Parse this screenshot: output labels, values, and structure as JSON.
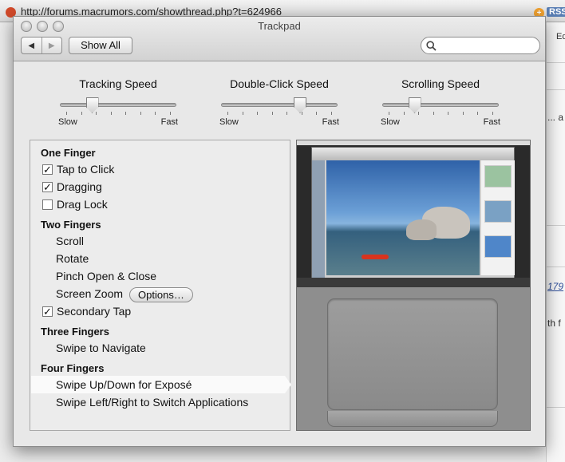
{
  "background_browser": {
    "url": "http://forums.macrumors.com/showthread.php?t=624966",
    "rss_label": "RSS",
    "side_fragments": [
      "Ed",
      "... a",
      "179",
      "th f"
    ]
  },
  "window": {
    "title": "Trackpad",
    "show_all_label": "Show All",
    "search_placeholder": ""
  },
  "sliders": [
    {
      "title": "Tracking Speed",
      "min_label": "Slow",
      "max_label": "Fast",
      "value": 0.25
    },
    {
      "title": "Double-Click Speed",
      "min_label": "Slow",
      "max_label": "Fast",
      "value": 0.7
    },
    {
      "title": "Scrolling Speed",
      "min_label": "Slow",
      "max_label": "Fast",
      "value": 0.25
    }
  ],
  "options": {
    "one_finger": {
      "heading": "One Finger",
      "tap_to_click": {
        "label": "Tap to Click",
        "checked": true
      },
      "dragging": {
        "label": "Dragging",
        "checked": true
      },
      "drag_lock": {
        "label": "Drag Lock",
        "checked": false
      }
    },
    "two_fingers": {
      "heading": "Two Fingers",
      "scroll": "Scroll",
      "rotate": "Rotate",
      "pinch": "Pinch Open & Close",
      "screen_zoom": "Screen Zoom",
      "options_button": "Options…",
      "secondary_tap": {
        "label": "Secondary Tap",
        "checked": true
      }
    },
    "three_fingers": {
      "heading": "Three Fingers",
      "swipe": "Swipe to Navigate"
    },
    "four_fingers": {
      "heading": "Four Fingers",
      "expose": "Swipe Up/Down for Exposé",
      "switch_apps": "Swipe Left/Right to Switch Applications"
    }
  },
  "checkmark_glyph": "✓"
}
